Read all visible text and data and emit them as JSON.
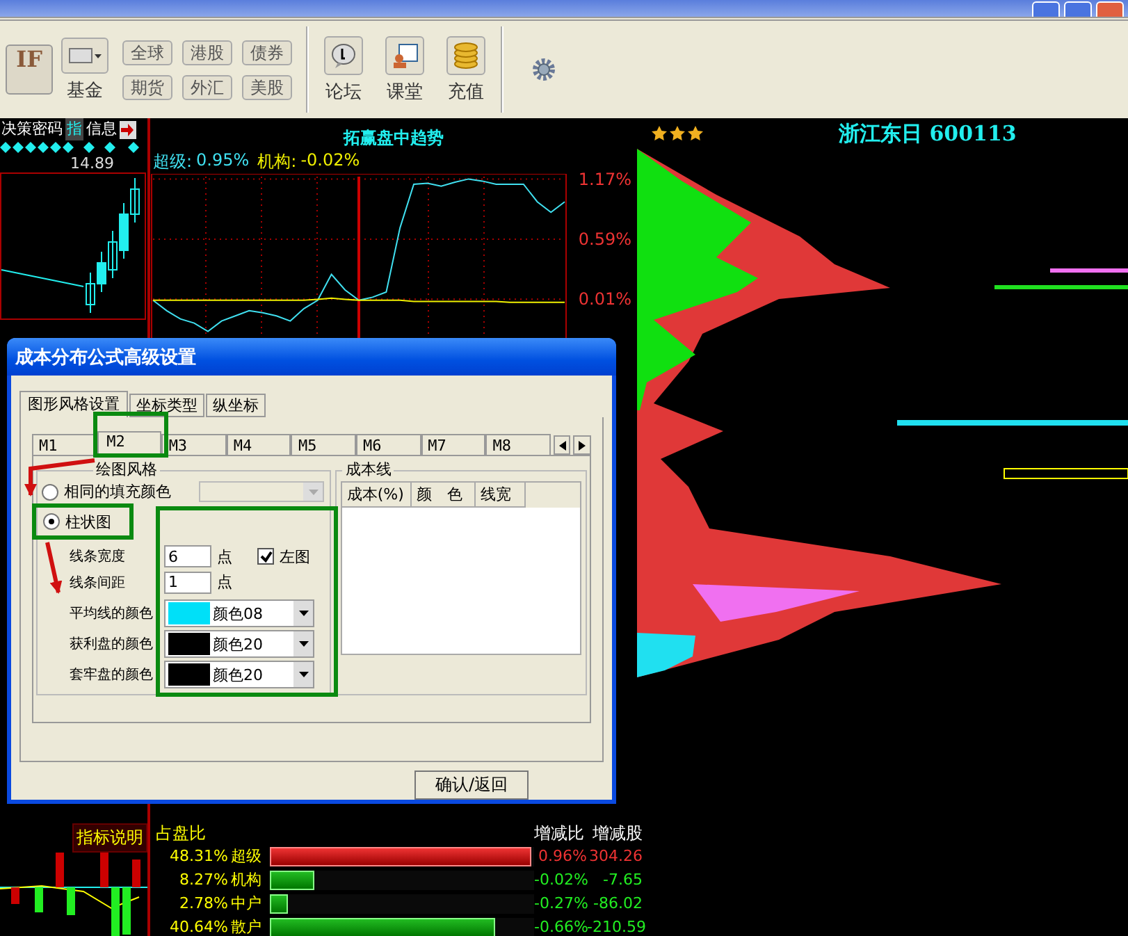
{
  "toolbar": {
    "logo": "IF",
    "fund": {
      "label": "基金"
    },
    "markets": [
      "全球",
      "港股",
      "债券",
      "期货",
      "外汇",
      "美股"
    ],
    "tools": [
      {
        "label": "论坛",
        "kind": "forum"
      },
      {
        "label": "课堂",
        "kind": "class"
      },
      {
        "label": "充值",
        "kind": "coins"
      }
    ]
  },
  "left_panel": {
    "tabs": [
      {
        "label": "决策密码",
        "selected": false
      },
      {
        "label": "指",
        "selected": true
      },
      {
        "label": "信息",
        "selected": false
      }
    ],
    "price": "14.89",
    "indicator_label": "指标说明"
  },
  "trend_chart": {
    "title": "拓赢盘中趋势",
    "legend": [
      {
        "value": "0.95%"
      },
      {
        "value": "-0.02%"
      }
    ],
    "chart_data": {
      "type": "line",
      "grid": true,
      "ylim": [
        -0.39,
        1.22
      ],
      "yticks": [
        {
          "value": 1.17,
          "label": "1.17%"
        },
        {
          "value": 0.59,
          "label": "0.59%"
        },
        {
          "value": 0.01,
          "label": "0.01%"
        }
      ],
      "series": [
        {
          "name": "超级:",
          "color": "#40e0f0",
          "values": [
            0,
            -0.1,
            -0.18,
            -0.22,
            -0.3,
            -0.2,
            -0.15,
            -0.1,
            -0.12,
            -0.15,
            -0.2,
            -0.08,
            0,
            0.25,
            0.1,
            0,
            0.03,
            0.08,
            0.7,
            1.12,
            1.13,
            1.1,
            1.14,
            1.17,
            1.15,
            1.12,
            1.12,
            1.12,
            0.95,
            0.85,
            0.95
          ]
        },
        {
          "name": "机构:",
          "color": "#f0f000",
          "values": [
            0,
            0,
            0,
            0,
            0,
            0,
            0,
            0,
            0,
            0,
            0,
            0,
            0.01,
            0.02,
            0.01,
            0,
            0,
            0,
            0,
            -0.01,
            -0.01,
            -0.01,
            -0.01,
            -0.01,
            -0.01,
            -0.01,
            -0.02,
            -0.02,
            -0.02,
            -0.02,
            -0.02
          ]
        }
      ]
    }
  },
  "stock": {
    "stars": 3,
    "name": "浙江东日",
    "code": "600113"
  },
  "holdings": {
    "headers": [
      "占盘比",
      "增减比",
      "增减股"
    ],
    "rows": [
      {
        "share": "48.31%",
        "name": "超级",
        "level": 0.99,
        "change": "0.96%",
        "shares": "304.26",
        "kind": "up"
      },
      {
        "share": "8.27%",
        "name": "机构",
        "level": 0.17,
        "change": "-0.02%",
        "shares": "-7.65",
        "kind": "down"
      },
      {
        "share": "2.78%",
        "name": "中户",
        "level": 0.07,
        "change": "-0.27%",
        "shares": "-86.02",
        "kind": "down"
      },
      {
        "share": "40.64%",
        "name": "散户",
        "level": 0.85,
        "change": "-0.66%",
        "shares": "-210.59",
        "kind": "down"
      }
    ]
  },
  "dialog": {
    "title": "成本分布公式高级设置",
    "tabs": [
      {
        "label": "图形风格设置",
        "selected": true
      },
      {
        "label": "坐标类型",
        "selected": false
      },
      {
        "label": "纵坐标",
        "selected": false
      }
    ],
    "formula_tabs": [
      {
        "label": "M1",
        "selected": false
      },
      {
        "label": "M2",
        "selected": true
      },
      {
        "label": "M3",
        "selected": false
      },
      {
        "label": "M4",
        "selected": false
      },
      {
        "label": "M5",
        "selected": false
      },
      {
        "label": "M6",
        "selected": false
      },
      {
        "label": "M7",
        "selected": false
      },
      {
        "label": "M8",
        "selected": false
      }
    ],
    "style_group": {
      "title": "绘图风格",
      "options": [
        {
          "label": "相同的填充颜色",
          "selected": false
        },
        {
          "label": "柱状图",
          "selected": true
        }
      ],
      "line_width": {
        "label": "线条宽度",
        "value": "6",
        "unit": "点"
      },
      "left_chart": {
        "label": "左图",
        "checked": true
      },
      "line_spacing": {
        "label": "线条间距",
        "value": "1",
        "unit": "点"
      },
      "colors": [
        {
          "label": "平均线的颜色",
          "swatch": "颜色08",
          "color": "#00e0f8"
        },
        {
          "label": "获利盘的颜色",
          "swatch": "颜色20",
          "color": "#000000"
        },
        {
          "label": "套牢盘的颜色",
          "swatch": "颜色20",
          "color": "#000000"
        }
      ]
    },
    "cost_line_group": {
      "title": "成本线",
      "columns": [
        "成本(%)",
        "颜　色",
        "线宽"
      ]
    },
    "confirm_button": "确认/返回"
  }
}
